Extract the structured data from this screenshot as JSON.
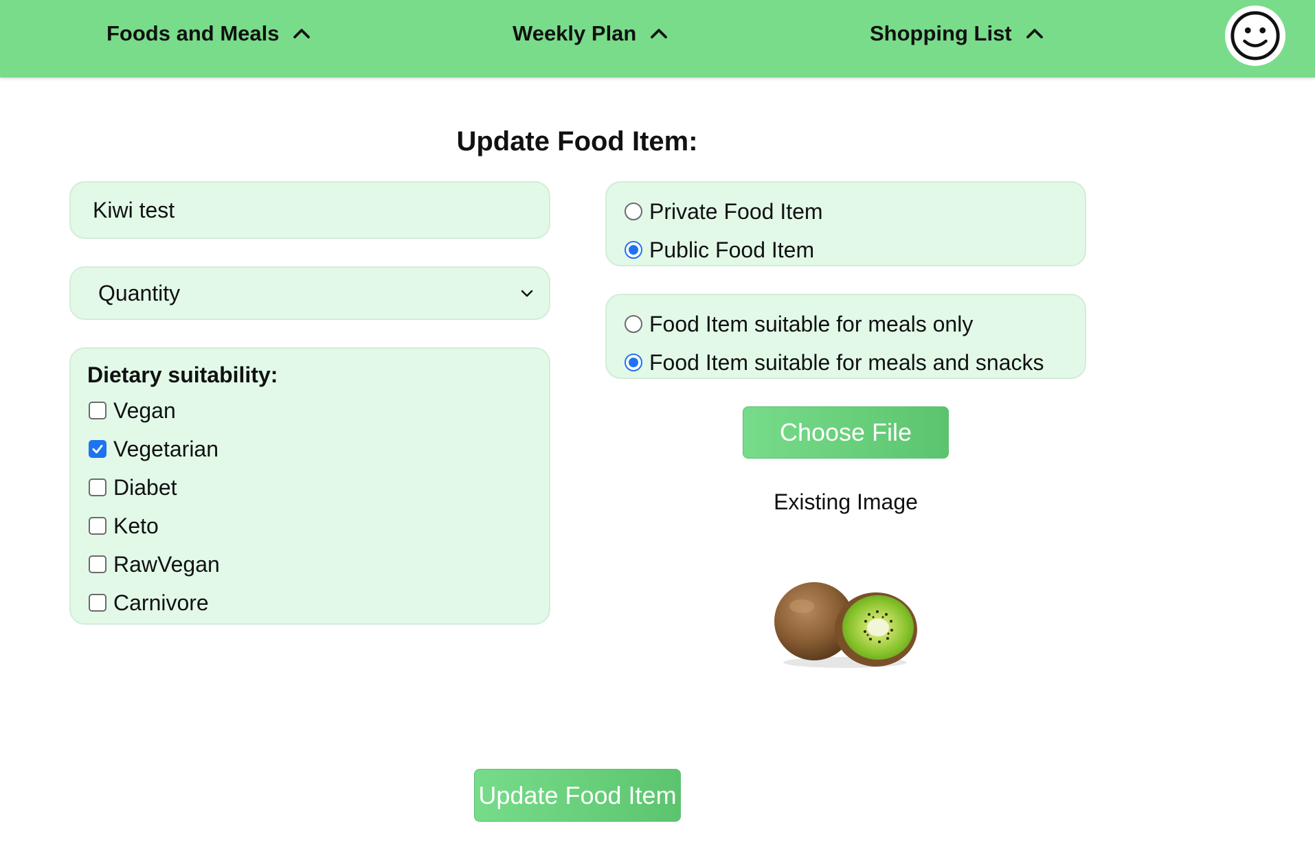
{
  "navbar": {
    "items": [
      {
        "label": "Foods and Meals",
        "icon": "chevron-up-icon"
      },
      {
        "label": "Weekly Plan",
        "icon": "chevron-up-icon"
      },
      {
        "label": "Shopping List",
        "icon": "chevron-up-icon"
      }
    ],
    "avatar_icon": "smiley-face-icon",
    "background_color": "#79dc8a"
  },
  "form": {
    "title": "Update Food Item:",
    "name_input": {
      "value": "Kiwi test"
    },
    "quantity_select": {
      "selected": "Quantity",
      "icon": "chevron-down-icon"
    },
    "dietary": {
      "heading": "Dietary suitability:",
      "options": [
        {
          "label": "Vegan",
          "checked": false
        },
        {
          "label": "Vegetarian",
          "checked": true
        },
        {
          "label": "Diabet",
          "checked": false
        },
        {
          "label": "Keto",
          "checked": false
        },
        {
          "label": "RawVegan",
          "checked": false
        },
        {
          "label": "Carnivore",
          "checked": false
        }
      ]
    },
    "visibility": {
      "options": [
        {
          "label": "Private Food Item",
          "checked": false
        },
        {
          "label": "Public Food Item",
          "checked": true
        }
      ]
    },
    "suitability": {
      "options": [
        {
          "label": "Food Item suitable for meals only",
          "checked": false
        },
        {
          "label": "Food Item suitable for meals and snacks",
          "checked": true
        }
      ]
    },
    "choose_file_label": "Choose File",
    "existing_image_label": "Existing Image",
    "existing_image_icon": "kiwi-image",
    "submit_label": "Update Food Item"
  },
  "colors": {
    "accent_green": "#79dc8a",
    "panel_bg": "#e2f9e8",
    "checked_blue": "#1f73f0"
  }
}
